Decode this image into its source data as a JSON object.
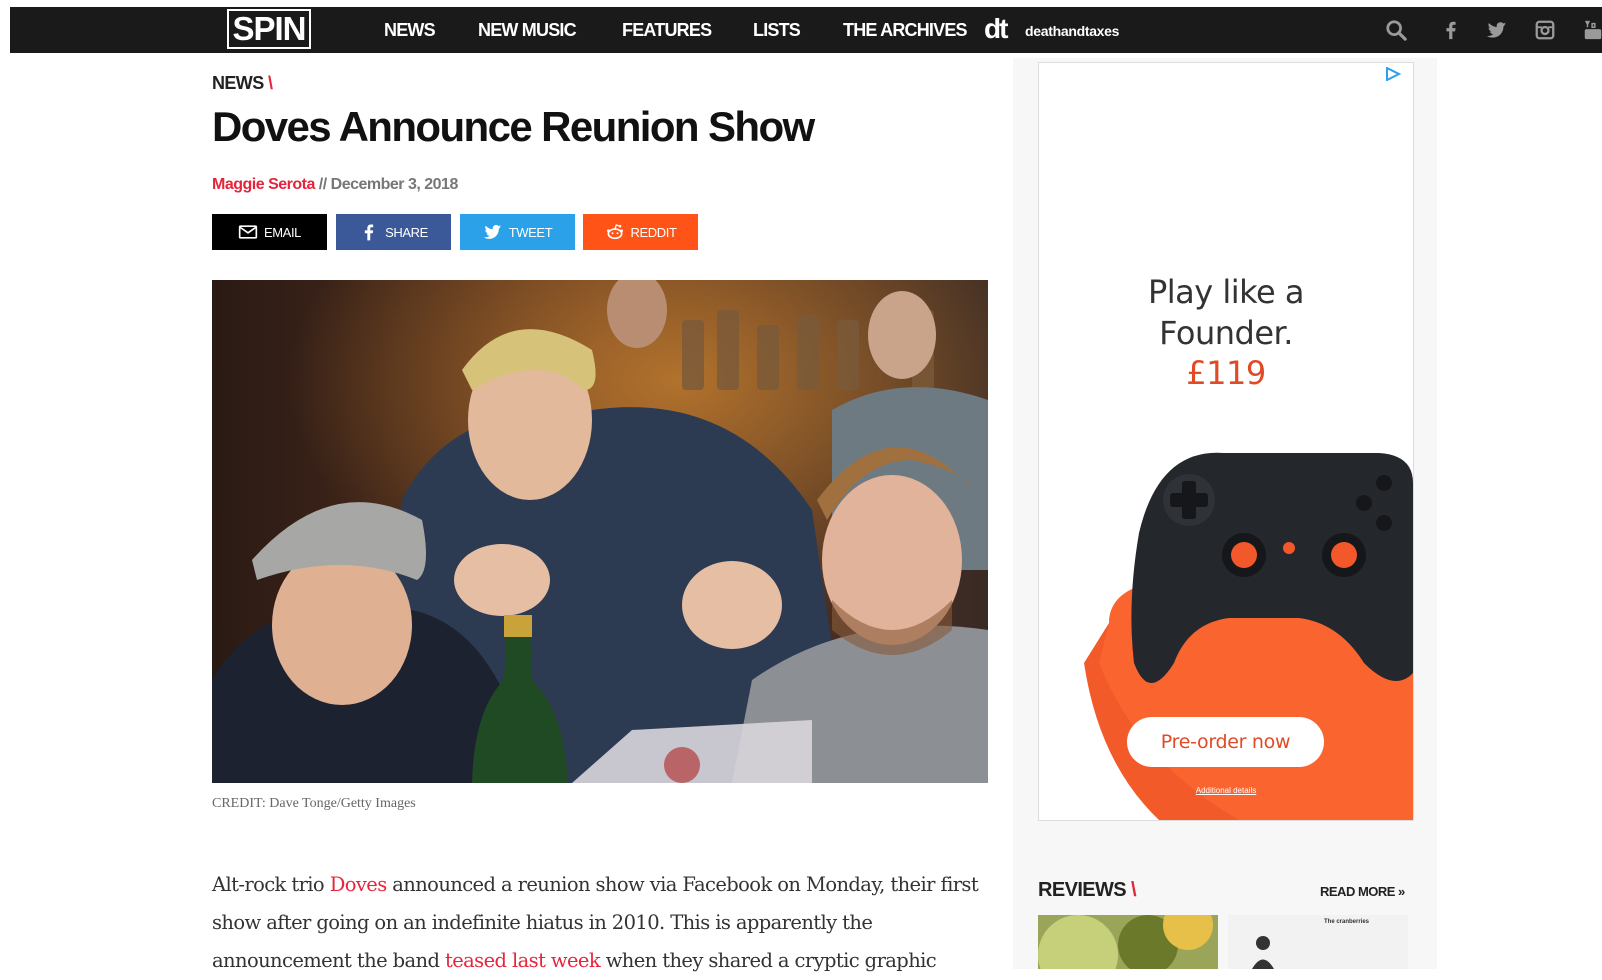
{
  "nav": {
    "logo": "SPIN",
    "items": [
      "NEWS",
      "NEW MUSIC",
      "FEATURES",
      "LISTS",
      "THE ARCHIVES"
    ],
    "partner_mark": "dt",
    "partner_name": "deathandtaxes",
    "icons": [
      "search-icon",
      "facebook-icon",
      "twitter-icon",
      "instagram-icon",
      "youtube-icon"
    ]
  },
  "article": {
    "section": "NEWS",
    "section_slash": "\\",
    "title": "Doves Announce Reunion Show",
    "author": "Maggie Serota",
    "date_separator": " // ",
    "date": "December 3, 2018",
    "share": {
      "email": "EMAIL",
      "share": "SHARE",
      "tweet": "TWEET",
      "reddit": "REDDIT"
    },
    "caption": "CREDIT: Dave Tonge/Getty Images",
    "body": {
      "p1_a": "Alt-rock trio ",
      "link1": "Doves",
      "p1_b": " announced a reunion show via Facebook on Monday, their first show after going on an indefinite hiatus in 2010. This is apparently the announcement the band ",
      "link2": "teased last week",
      "p1_c": " when they shared a cryptic graphic"
    }
  },
  "ad": {
    "line1": "Play like a",
    "line2": "Founder.",
    "price": "£119",
    "cta": "Pre-order now",
    "fine_print": "Additional details"
  },
  "sidebar": {
    "reviews_label": "REVIEWS",
    "reviews_slash": "\\",
    "read_more": "READ MORE »",
    "thumb2_title": "The cranberries"
  },
  "colors": {
    "accent": "#e5253b",
    "nav_bg": "#1a1a1a",
    "facebook": "#3b5998",
    "twitter": "#2ba1ea",
    "reddit": "#ff5317",
    "ad_orange": "#e04a25"
  }
}
